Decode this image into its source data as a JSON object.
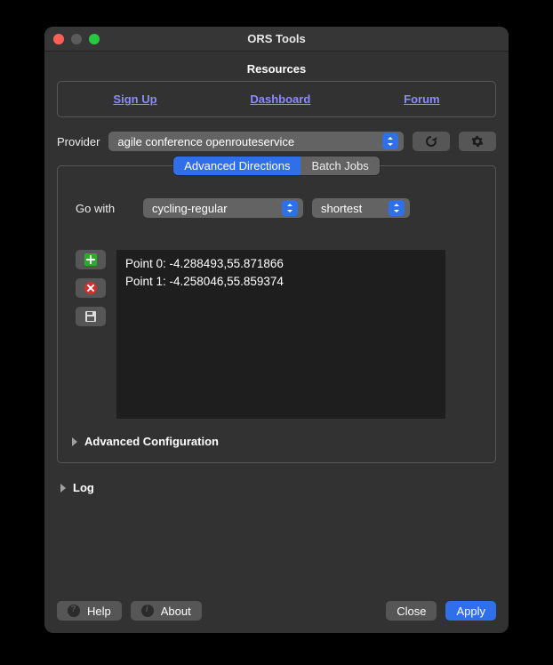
{
  "window": {
    "title": "ORS Tools"
  },
  "resources": {
    "heading": "Resources",
    "links": {
      "signup": "Sign Up",
      "dashboard": "Dashboard",
      "forum": "Forum"
    }
  },
  "provider": {
    "label": "Provider",
    "selected": "agile conference openrouteservice"
  },
  "tabs": {
    "advanced": "Advanced Directions",
    "batch": "Batch Jobs"
  },
  "gowith": {
    "label": "Go with",
    "profile": "cycling-regular",
    "preference": "shortest"
  },
  "points": [
    "Point 0: -4.288493,55.871866",
    "Point 1: -4.258046,55.859374"
  ],
  "advanced_config": {
    "label": "Advanced Configuration"
  },
  "log": {
    "label": "Log"
  },
  "buttons": {
    "help": "Help",
    "about": "About",
    "close": "Close",
    "apply": "Apply"
  }
}
